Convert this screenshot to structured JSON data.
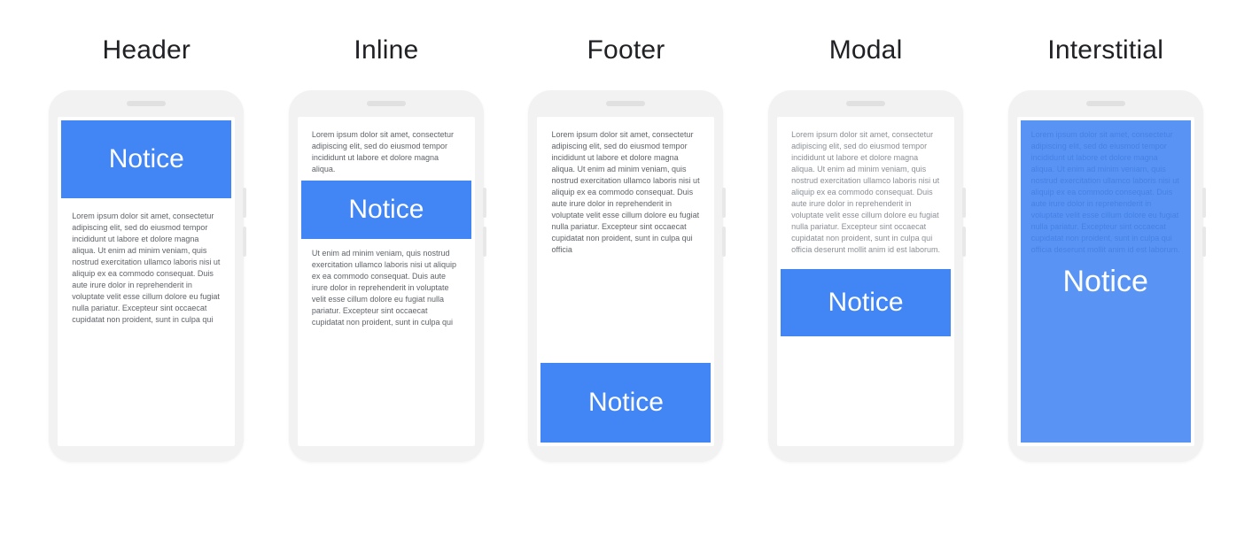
{
  "notice_label": "Notice",
  "variants": [
    {
      "key": "header",
      "title": "Header"
    },
    {
      "key": "inline",
      "title": "Inline"
    },
    {
      "key": "footer",
      "title": "Footer"
    },
    {
      "key": "modal",
      "title": "Modal"
    },
    {
      "key": "interstitial",
      "title": "Interstitial"
    }
  ],
  "lorem": {
    "p1": "Lorem ipsum dolor sit amet, consectetur adipiscing elit, sed do eiusmod tempor incididunt ut labore et dolore magna aliqua. Ut enim ad minim veniam, quis nostrud exercitation ullamco laboris nisi ut aliquip ex ea commodo consequat. Duis aute irure dolor in reprehenderit in voluptate velit esse cillum dolore eu fugiat nulla pariatur. Excepteur sint occaecat cupidatat non proident, sunt in culpa qui",
    "short_top": "Lorem ipsum dolor sit amet, consectetur adipiscing elit, sed do eiusmod tempor incididunt ut labore et dolore magna aliqua.",
    "short_bottom": "Ut enim ad minim veniam, quis nostrud exercitation ullamco laboris nisi ut aliquip ex ea commodo consequat. Duis aute irure dolor in reprehenderit in voluptate velit esse cillum dolore eu fugiat nulla pariatur. Excepteur sint occaecat cupidatat non proident, sunt in culpa qui",
    "footer_body": "Lorem ipsum dolor sit amet, consectetur adipiscing elit, sed do eiusmod tempor incididunt ut labore et dolore magna aliqua. Ut enim ad minim veniam, quis nostrud exercitation ullamco laboris nisi ut aliquip ex ea commodo consequat. Duis aute irure dolor in reprehenderit in voluptate velit esse cillum dolore eu fugiat nulla pariatur. Excepteur sint occaecat cupidatat non proident, sunt in culpa qui officia",
    "modal_body": "Lorem ipsum dolor sit amet, consectetur adipiscing elit, sed do eiusmod tempor incididunt ut labore et dolore magna aliqua. Ut enim ad minim veniam, quis nostrud exercitation ullamco laboris nisi ut aliquip ex ea commodo consequat. Duis aute irure dolor in reprehenderit in voluptate velit esse cillum dolore eu fugiat nulla pariatur. Excepteur sint occaecat cupidatat non proident, sunt in culpa qui officia deserunt mollit anim id est laborum.",
    "inter_body": "Lorem ipsum dolor sit amet, consectetur adipiscing elit, sed do eiusmod tempor incididunt ut labore et dolore magna aliqua. Ut enim ad minim veniam, quis nostrud exercitation ullamco laboris nisi ut aliquip ex ea commodo consequat. Duis aute irure dolor in reprehenderit in voluptate velit esse cillum dolore eu fugiat nulla pariatur. Excepteur sint occaecat cupidatat non proident, sunt in culpa qui officia deserunt mollit anim id est laborum."
  },
  "colors": {
    "blue": "#4285f4",
    "white": "#ffffff",
    "grey_text": "#5f6368",
    "device_bg": "#f2f2f2"
  }
}
